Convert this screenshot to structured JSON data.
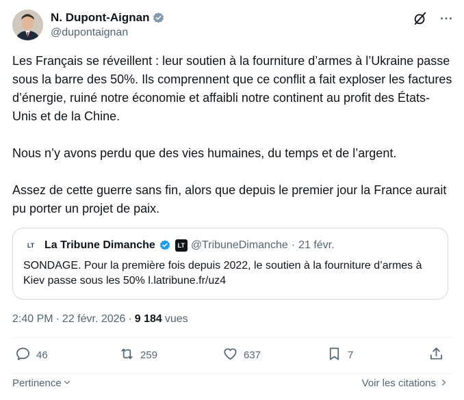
{
  "author": {
    "display_name": "N. Dupont-Aignan",
    "handle": "@dupontaignan"
  },
  "tweet": {
    "paragraphs": [
      "Les Français se réveillent : leur soutien à la fourniture d’armes à l’Ukraine passe sous la barre des 50%. Ils comprennent que ce conflit a fait exploser les factures d’énergie, ruiné notre économie et affaibli notre continent au profit des États-Unis et de la Chine.",
      "Nous n’y avons perdu que des vies humaines, du temps et de l’argent.",
      "Assez de cette guerre sans fin, alors que depuis le premier jour la France aurait pu porter un projet de paix."
    ]
  },
  "quote": {
    "logo_text": "LT",
    "name": "La Tribune Dimanche",
    "badge_text": "LT",
    "handle": "@TribuneDimanche",
    "separator": "·",
    "date": "21 févr.",
    "text": "SONDAGE. Pour la première fois depuis 2022, le soutien à la fourniture d’armes à Kiev passe sous les 50% l.latribune.fr/uz4"
  },
  "meta": {
    "time": "2:40 PM",
    "separator1": "·",
    "date": "22 févr. 2026",
    "separator2": "·",
    "views_count": "9 184",
    "views_label": "vues"
  },
  "actions": {
    "replies": "46",
    "reposts": "259",
    "likes": "637",
    "bookmarks": "7"
  },
  "footer": {
    "sort_label": "Pertinence",
    "quotes_link": "Voir les citations"
  },
  "icons": {
    "verified": "verified-badge-icon",
    "grok": "grok-icon",
    "more": "more-icon",
    "reply": "reply-icon",
    "repost": "repost-icon",
    "like": "heart-icon",
    "bookmark": "bookmark-icon",
    "share": "share-icon"
  },
  "colors": {
    "text": "#0f1419",
    "secondary": "#536471",
    "border": "#cfd9de",
    "verified": "#829aab"
  }
}
